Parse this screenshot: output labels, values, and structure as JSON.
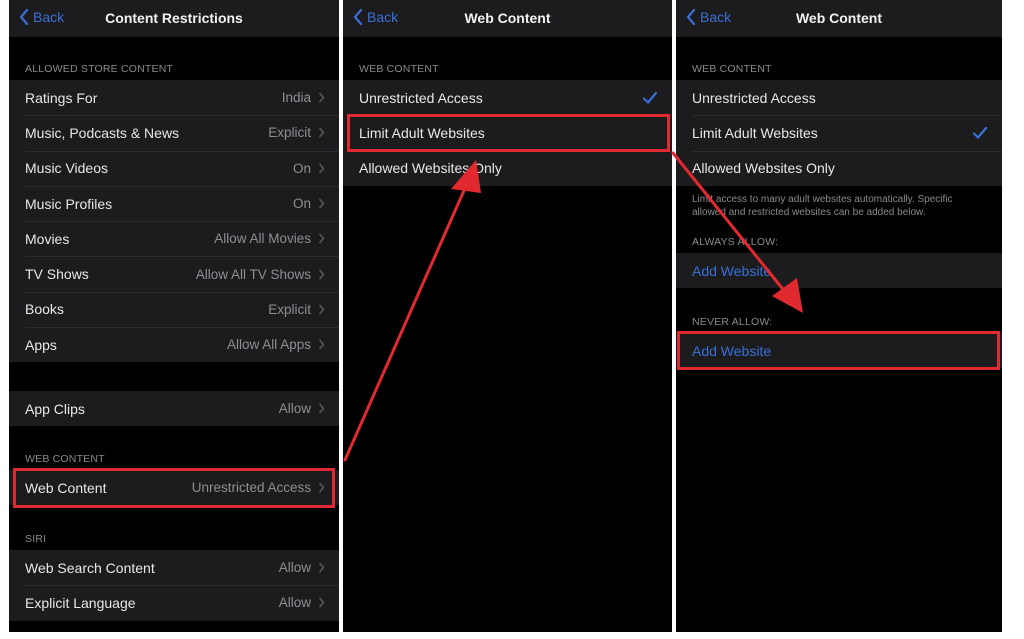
{
  "colors": {
    "accent_blue": "#3a6fd8",
    "annotation_red": "#e02a2f",
    "row_background": "#1c1c1e",
    "page_background": "#000000"
  },
  "panels": [
    {
      "nav": {
        "back_label": "Back",
        "back_icon": "chevron-left-icon",
        "title": "Content Restrictions"
      },
      "sections": [
        {
          "header": "ALLOWED STORE CONTENT",
          "rows": [
            {
              "label": "Ratings For",
              "value": "India"
            },
            {
              "label": "Music, Podcasts & News",
              "value": "Explicit"
            },
            {
              "label": "Music Videos",
              "value": "On"
            },
            {
              "label": "Music Profiles",
              "value": "On"
            },
            {
              "label": "Movies",
              "value": "Allow All Movies"
            },
            {
              "label": "TV Shows",
              "value": "Allow All TV Shows"
            },
            {
              "label": "Books",
              "value": "Explicit"
            },
            {
              "label": "Apps",
              "value": "Allow All Apps"
            }
          ]
        },
        {
          "header": "",
          "rows": [
            {
              "label": "App Clips",
              "value": "Allow"
            }
          ]
        },
        {
          "header": "WEB CONTENT",
          "rows": [
            {
              "label": "Web Content",
              "value": "Unrestricted Access",
              "highlighted": true
            }
          ]
        },
        {
          "header": "SIRI",
          "rows": [
            {
              "label": "Web Search Content",
              "value": "Allow"
            },
            {
              "label": "Explicit Language",
              "value": "Allow"
            }
          ]
        }
      ]
    },
    {
      "nav": {
        "back_label": "Back",
        "back_icon": "chevron-left-icon",
        "title": "Web Content"
      },
      "sections": [
        {
          "header": "WEB CONTENT",
          "rows": [
            {
              "label": "Unrestricted Access",
              "checked": true
            },
            {
              "label": "Limit Adult Websites",
              "checked": false,
              "highlighted": true
            },
            {
              "label": "Allowed Websites Only",
              "checked": false
            }
          ]
        }
      ]
    },
    {
      "nav": {
        "back_label": "Back",
        "back_icon": "chevron-left-icon",
        "title": "Web Content"
      },
      "sections": [
        {
          "header": "WEB CONTENT",
          "rows": [
            {
              "label": "Unrestricted Access",
              "checked": false
            },
            {
              "label": "Limit Adult Websites",
              "checked": true
            },
            {
              "label": "Allowed Websites Only",
              "checked": false
            }
          ],
          "footer": "Limit access to many adult websites automatically. Specific allowed and restricted websites can be added below."
        },
        {
          "header": "ALWAYS ALLOW:",
          "rows": [
            {
              "link": "Add Website"
            }
          ]
        },
        {
          "header": "NEVER ALLOW:",
          "rows": [
            {
              "link": "Add Website",
              "highlighted": true
            }
          ]
        }
      ]
    }
  ],
  "annotations": [
    {
      "type": "arrow",
      "from": "panel-1 web-content row",
      "to": "panel-2 limit-adult-websites row"
    },
    {
      "type": "arrow",
      "from": "panel-2 limit-adult-websites row",
      "to": "panel-3 never-allow add-website row"
    }
  ]
}
